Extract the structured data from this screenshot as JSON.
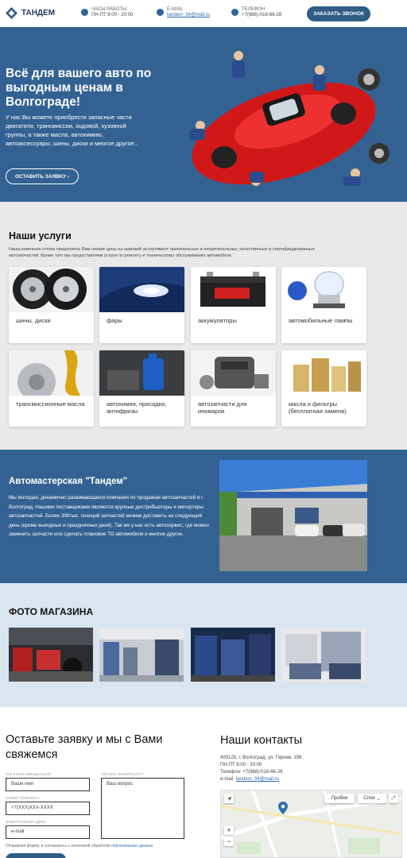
{
  "header": {
    "logo_text": "ТАНДЕМ",
    "hours_label": "ЧАСЫ РАБОТЫ:",
    "hours_value": "ПН-ПТ 9:00 - 20:00",
    "email_label": "E-MAIL",
    "email_value": "tandem_34@mail.ru",
    "phone_label": "ТЕЛЕФОН",
    "phone_value": "+7(988)-016-66-28",
    "call_button": "ЗАКАЗАТЬ ЗВОНОК"
  },
  "hero": {
    "title": "Всё для вашего авто по выгодным ценам в Волгограде!",
    "text": "У нас Вы можете приобрести запасные части двигателя, трансмиссии, ходовой, кузовной группы, а также масла, автохимию, автоаксессуары, шины, диски и многое другое..",
    "button": "ОСТАВИТЬ ЗАЯВКУ ›"
  },
  "services": {
    "title": "Наши услуги",
    "intro": "Наша компания готова предложить Вам низкие цены на широкий ассортимент оригинальных и неоригинальных, качественных и сертифицированных автозапчастей. Кроме того мы предоставляем услуги по ремонту и техническому обслуживанию автомобиля.",
    "items": [
      {
        "label": "шины, диски"
      },
      {
        "label": "фары"
      },
      {
        "label": "аккумуляторы"
      },
      {
        "label": "автомобильные лампы"
      },
      {
        "label": "трансмиссионные масла"
      },
      {
        "label": "автохимия, присадки, антифризы"
      },
      {
        "label": "автозапчасти для иномарок"
      },
      {
        "label": "масла и фильтры (бесплатная замена)"
      }
    ]
  },
  "about": {
    "title": "Автомастерская \"Тандем\"",
    "text": "Мы молодая, динамично развивающаяся компания по продажам автозапчастей в г. Волгоград. Нашими поставщиками являются крупные дистрибьюторы и импортеры автозапчастей. Более 300тыс. позиций запчастей можем доставить на следующий день (кроме выходных и праздничных дней). Так же у нас есть автосервис, где можно заменить запчасти или сделать плановое ТО автомобиля и многое другое."
  },
  "gallery": {
    "title": "ФОТО МАГАЗИНА"
  },
  "form": {
    "title": "Оставьте заявку и мы с Вами свяжемся",
    "name_label": "КАК К ВАМ ОБРАЩАТЬСЯ?",
    "name_placeholder": "Ваше имя",
    "question_label": "ЧТО ВАС ИНТЕРЕСУЕТ?",
    "question_placeholder": "Ваш вопрос",
    "phone_label": "НОМЕР ТЕЛЕФОНА",
    "phone_placeholder": "+7(XXX)XXX-XXXX",
    "email_label": "ЭЛЕКТРОННЫЙ АДРЕС",
    "email_placeholder": "e-mail",
    "consent_text": "Отправляя форму, я соглашаюсь с политикой обработки",
    "consent_link": "персональных данных"
  },
  "contacts": {
    "title": "Наши контакты",
    "address": "400125, г. Волгоград, ул. Героев, 156",
    "hours": "ПН-ПТ 9:00 - 20:00",
    "phone": "Телефон: +7(988)-016-66-28",
    "email_label": "e-mail:",
    "email": "tandem_34@mail.ru",
    "map_traffic": "Пробки",
    "map_layers": "Слои"
  },
  "colors": {
    "brand": "#336292",
    "button": "#2f5d86",
    "link": "#2d6db3",
    "section_gray": "#e9e9e9",
    "section_light_blue": "#d9e6f0"
  }
}
